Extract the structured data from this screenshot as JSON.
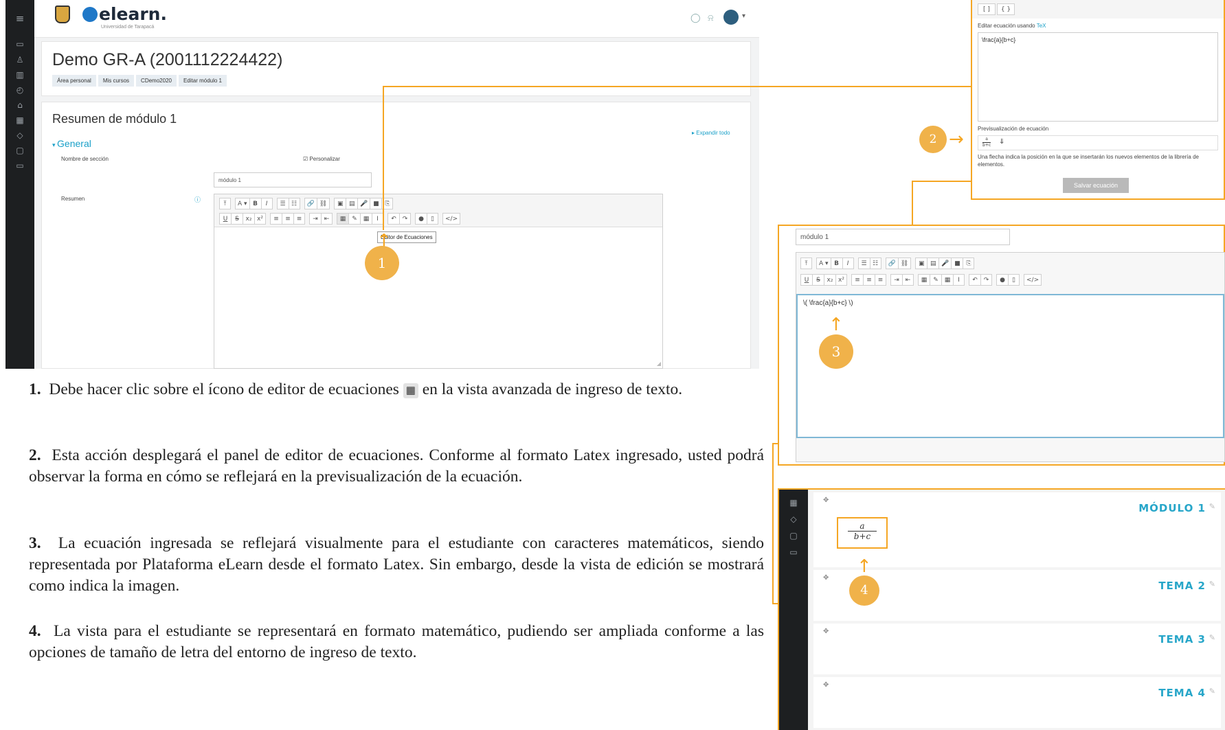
{
  "app": {
    "logo_text": "elearn.",
    "logo_sub": "Universidad de Tarapacá",
    "topbar_user_arrow": "▾"
  },
  "course": {
    "title": "Demo GR-A (2001112224422)",
    "breadcrumb": [
      "Área personal",
      "Mis cursos",
      "CDemo2020",
      "Editar módulo 1"
    ]
  },
  "form": {
    "heading": "Resumen de módulo 1",
    "expand_all": "Expandir todo",
    "section_general": "General",
    "label_section_name": "Nombre de sección",
    "customize_label": "Personalizar",
    "section_name_value": "módulo 1",
    "label_summary": "Resumen",
    "tooltip_equation": "Editor de Ecuaciones"
  },
  "toolbar": {
    "row1": [
      "⤒",
      "A ▾",
      "B",
      "I",
      "☰",
      "☷",
      "🔗",
      "⛓",
      "▣",
      "▤",
      "🎤",
      "■",
      "⎘"
    ],
    "row2": [
      "U",
      "S",
      "x₂",
      "x²",
      "≡",
      "≡",
      "≡",
      "⇥",
      "⇤",
      "▦",
      "✎",
      "▦",
      "I",
      "↶",
      "↷",
      "●",
      "▯",
      "</>"
    ]
  },
  "equation_panel": {
    "matrix_buttons": [
      "[ ]",
      "{ }"
    ],
    "editor_label": "Editar ecuación usando",
    "editor_label_link": "TeX",
    "tex_value": "\\frac{a}{b+c}",
    "preview_label": "Previsualización de ecuación",
    "preview_formula_num": "a",
    "preview_formula_den": "b+c",
    "arrow_hint": "Una flecha indica la posición en la que se insertarán los nuevos elementos de la librería de elementos.",
    "save_button": "Salvar ecuación"
  },
  "editor_panel": {
    "section_name_value": "módulo 1",
    "content_text": "\\( \\frac{a}{b+c} \\)"
  },
  "course_view": {
    "sections": [
      "MÓDULO 1",
      "TEMA 2",
      "TEMA 3",
      "TEMA 4"
    ],
    "move_glyph": "✥",
    "edit_glyph": "✎",
    "formula_num": "a",
    "formula_den": "b+c"
  },
  "callouts": [
    "1",
    "2",
    "3",
    "4"
  ],
  "instructions": [
    {
      "num": "1.",
      "text_before": "Debe hacer clic sobre el ícono de editor de ecuaciones",
      "icon": "▦",
      "text_after": "en la vista avanzada de ingreso de texto."
    },
    {
      "num": "2.",
      "text": "Esta acción desplegará el panel de editor de ecuaciones. Conforme al formato Latex ingresado, usted podrá observar la forma en cómo se reflejará en la previsualización de la ecuación."
    },
    {
      "num": "3.",
      "text": "La ecuación ingresada se reflejará visualmente para el estudiante con caracteres matemáticos, siendo representada por Plataforma eLearn desde el formato Latex. Sin embargo, desde la vista de edición se mostrará como indica la imagen."
    },
    {
      "num": "4.",
      "text": "La vista para el estudiante se representará en formato matemático, pudiendo ser ampliada conforme a las opciones de tamaño de letra del entorno de ingreso de texto."
    }
  ],
  "colors": {
    "accent_orange": "#f5a623",
    "callout_fill": "#f0b24a",
    "section_teal": "#27a6c9",
    "sidebar_dark": "#1d1f21"
  }
}
